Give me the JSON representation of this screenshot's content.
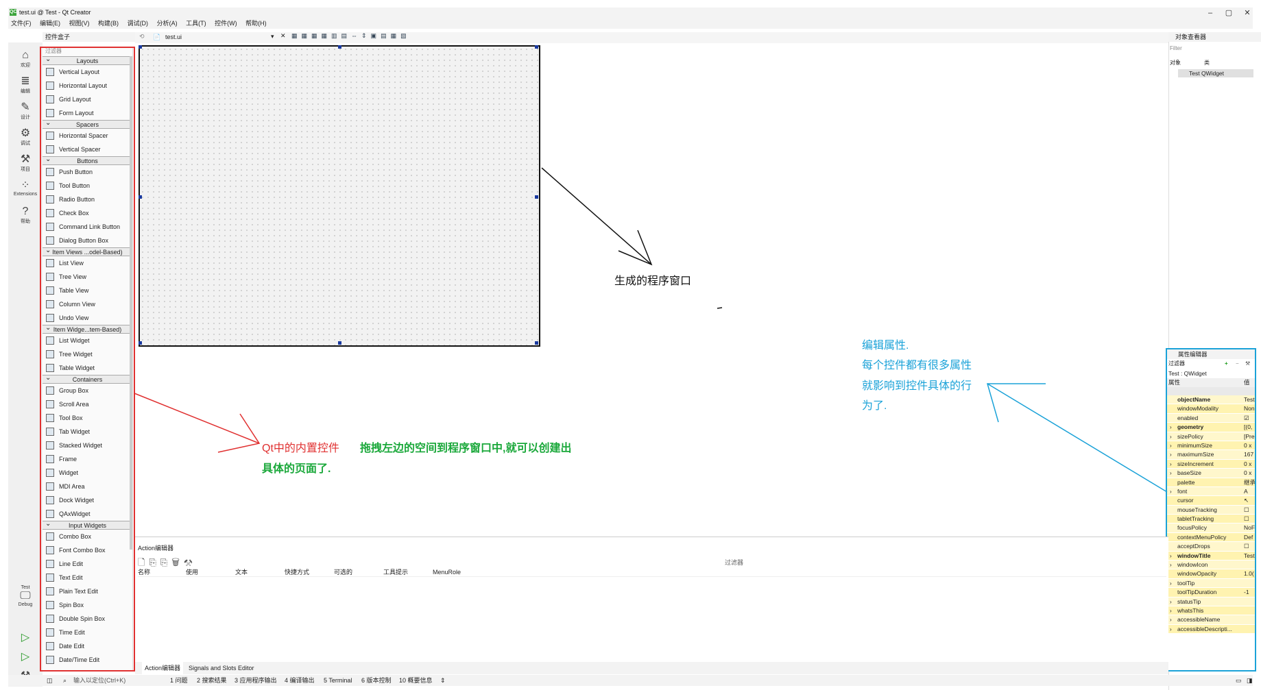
{
  "window": {
    "title": "test.ui @ Test - Qt Creator",
    "logo": "QC",
    "min": "–",
    "max": "▢",
    "close": "✕"
  },
  "menu": [
    "文件(F)",
    "编辑(E)",
    "视图(V)",
    "构建(B)",
    "调试(D)",
    "分析(A)",
    "工具(T)",
    "控件(W)",
    "帮助(H)"
  ],
  "modes": [
    {
      "label": "欢迎",
      "icon": "home-icon",
      "glyph": "⌂"
    },
    {
      "label": "编辑",
      "icon": "edit-icon",
      "glyph": "≣"
    },
    {
      "label": "设计",
      "icon": "design-icon",
      "glyph": "✎"
    },
    {
      "label": "调试",
      "icon": "debug-icon",
      "glyph": "⚙"
    },
    {
      "label": "项目",
      "icon": "wrench-icon",
      "glyph": "⚒"
    },
    {
      "label": "Extensions",
      "icon": "extensions-icon",
      "glyph": "⁘"
    },
    {
      "label": "帮助",
      "icon": "help-icon",
      "glyph": "?"
    }
  ],
  "kit": {
    "project": "Test",
    "config": "Debug"
  },
  "widgetbox": {
    "header": "控件盒子",
    "filter": "过滤器",
    "sections": [
      {
        "title": "Layouts",
        "items": [
          "Vertical Layout",
          "Horizontal Layout",
          "Grid Layout",
          "Form Layout"
        ]
      },
      {
        "title": "Spacers",
        "items": [
          "Horizontal Spacer",
          "Vertical Spacer"
        ]
      },
      {
        "title": "Buttons",
        "items": [
          "Push Button",
          "Tool Button",
          "Radio Button",
          "Check Box",
          "Command Link Button",
          "Dialog Button Box"
        ]
      },
      {
        "title": "Item Views ...odel-Based)",
        "items": [
          "List View",
          "Tree View",
          "Table View",
          "Column View",
          "Undo View"
        ]
      },
      {
        "title": "Item Widge...tem-Based)",
        "items": [
          "List Widget",
          "Tree Widget",
          "Table Widget"
        ]
      },
      {
        "title": "Containers",
        "items": [
          "Group Box",
          "Scroll Area",
          "Tool Box",
          "Tab Widget",
          "Stacked Widget",
          "Frame",
          "Widget",
          "MDI Area",
          "Dock Widget",
          "QAxWidget"
        ]
      },
      {
        "title": "Input Widgets",
        "items": [
          "Combo Box",
          "Font Combo Box",
          "Line Edit",
          "Text Edit",
          "Plain Text Edit",
          "Spin Box",
          "Double Spin Box",
          "Time Edit",
          "Date Edit",
          "Date/Time Edit"
        ]
      }
    ]
  },
  "editor": {
    "file": "test.ui"
  },
  "object_inspector": {
    "header": "对象查看器",
    "filter": "Filter",
    "col_object": "对象",
    "col_class": "类",
    "row": "Test  QWidget"
  },
  "property_editor": {
    "header": "属性编辑器",
    "filter": "过滤器",
    "context": "Test : QWidget",
    "col_prop": "属性",
    "col_val": "值",
    "rows": [
      {
        "name": "objectName",
        "value": "Test",
        "bold": true
      },
      {
        "name": "windowModality",
        "value": "NonModal"
      },
      {
        "name": "enabled",
        "value": "☑"
      },
      {
        "name": "geometry",
        "value": "[(0,",
        "bold": true,
        "expand": true
      },
      {
        "name": "sizePolicy",
        "value": "[Pre",
        "expand": true
      },
      {
        "name": "minimumSize",
        "value": "0 x",
        "expand": true
      },
      {
        "name": "maximumSize",
        "value": "167",
        "expand": true
      },
      {
        "name": "sizeIncrement",
        "value": "0 x",
        "expand": true
      },
      {
        "name": "baseSize",
        "value": "0 x",
        "expand": true
      },
      {
        "name": "palette",
        "value": "继承"
      },
      {
        "name": "font",
        "value": "A",
        "expand": true
      },
      {
        "name": "cursor",
        "value": "↖"
      },
      {
        "name": "mouseTracking",
        "value": "☐"
      },
      {
        "name": "tabletTracking",
        "value": "☐"
      },
      {
        "name": "focusPolicy",
        "value": "NoF"
      },
      {
        "name": "contextMenuPolicy",
        "value": "Def"
      },
      {
        "name": "acceptDrops",
        "value": "☐"
      },
      {
        "name": "windowTitle",
        "value": "Test",
        "bold": true,
        "expand": true
      },
      {
        "name": "windowIcon",
        "value": "",
        "expand": true
      },
      {
        "name": "windowOpacity",
        "value": "1.0("
      },
      {
        "name": "toolTip",
        "value": "",
        "expand": true
      },
      {
        "name": "toolTipDuration",
        "value": "-1"
      },
      {
        "name": "statusTip",
        "value": "",
        "expand": true
      },
      {
        "name": "whatsThis",
        "value": "",
        "expand": true
      },
      {
        "name": "accessibleName",
        "value": "",
        "expand": true
      },
      {
        "name": "accessibleDescripti...",
        "value": "",
        "expand": true
      }
    ]
  },
  "action_editor": {
    "title": "Action编辑器",
    "filter": "过滤器",
    "columns": [
      "名称",
      "使用",
      "文本",
      "快捷方式",
      "可选的",
      "工具提示",
      "MenuRole"
    ],
    "tabs": [
      "Action编辑器",
      "Signals and Slots Editor"
    ]
  },
  "statusbar": {
    "locate": "输入以定位(Ctrl+K)",
    "panes": [
      "1 问题",
      "2 搜索结果",
      "3 应用程序输出",
      "4 编译输出",
      "5 Terminal",
      "6 版本控制",
      "10 概要信息"
    ]
  },
  "annotations": {
    "window": "生成的程序窗口",
    "builtin": "Qt中的内置控件",
    "drag": "拖拽左边的空间到程序窗口中,就可以创建出",
    "drag2": "具体的页面了.",
    "props1": "编辑属性.",
    "props2": "每个控件都有很多属性",
    "props3": "就影响到控件具体的行",
    "props4": "为了."
  },
  "colors": {
    "red": "#e03030",
    "blue": "#1aa2d8",
    "green": "#1aa83a"
  }
}
